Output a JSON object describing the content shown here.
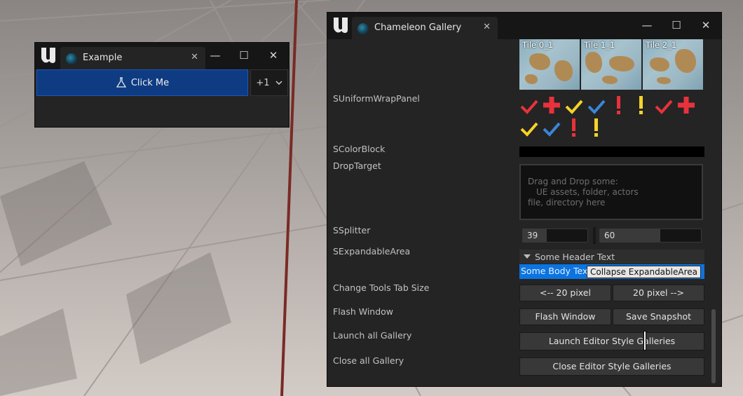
{
  "example_window": {
    "tab_title": "Example",
    "click_button": "Click Me",
    "plus_button": "+1"
  },
  "gallery_window": {
    "tab_title": "Chameleon Gallery",
    "tiles": [
      "Tile 0_1",
      "Tile 1_1",
      "Tile 2_1"
    ],
    "labels": {
      "uniform_wrap": "SUniformWrapPanel",
      "color_block": "SColorBlock",
      "drop_target": "DropTarget",
      "splitter": "SSplitter",
      "expandable": "SExpandableArea",
      "tab_size": "Change Tools Tab Size",
      "flash": "Flash Window",
      "launch_all": "Launch all Gallery",
      "close_all": "Close all Gallery"
    },
    "drop_text": [
      "Drag and Drop some:",
      "UE assets, folder, actors",
      "file, directory here"
    ],
    "splitter_values": {
      "left": "39",
      "right": "60"
    },
    "expandable": {
      "header": "Some Header Text",
      "body": "Some Body Text",
      "tooltip": "Collapse ExpandableArea"
    },
    "buttons": {
      "minus20": "<-- 20 pixel",
      "plus20": "20 pixel -->",
      "flash": "Flash Window",
      "snapshot": "Save Snapshot",
      "launch": "Launch Editor Style Galleries",
      "close": "Close Editor Style Galleries"
    },
    "icons": [
      "check-red",
      "plus-red",
      "check-yellow",
      "check-blue",
      "exclaim-red",
      "exclaim-yellow",
      "check-red",
      "plus-red",
      "check-yellow",
      "check-blue",
      "exclaim-red",
      "exclaim-yellow"
    ],
    "colors": {
      "red": "#e8323c",
      "yellow": "#f5d228",
      "blue": "#3a86d8",
      "accent": "#0b74e0"
    }
  }
}
